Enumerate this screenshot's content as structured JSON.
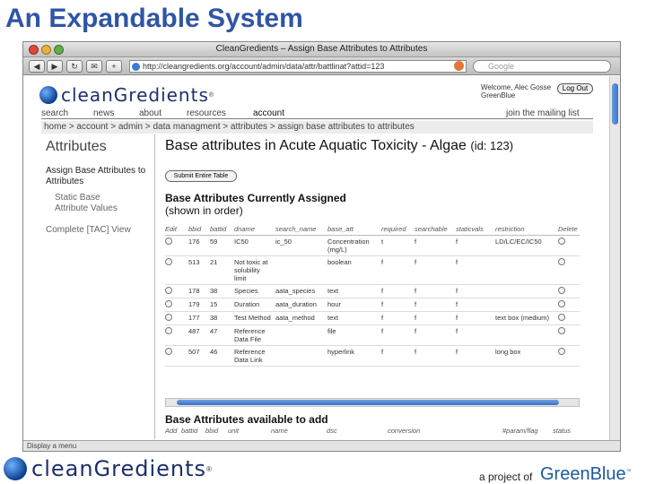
{
  "slide": {
    "title": "An Expandable System"
  },
  "window": {
    "title": "CleanGredients – Assign Base Attributes to Attributes",
    "url": "http://cleangredients.org/account/admin/data/attr/battlinat?attid=123",
    "search_placeholder": "Google",
    "toolbar_buttons": [
      "◀",
      "▶",
      "↻",
      "✉",
      "+"
    ]
  },
  "site": {
    "logo_text": "cleanGredients",
    "logo_mark": "®",
    "user_line1": "Welcome, Alec Gosse",
    "user_line2": "GreenBlue",
    "logout": "Log Out",
    "nav": [
      "search",
      "news",
      "about",
      "resources",
      "account"
    ],
    "join": "join the mailing list",
    "breadcrumb": "home > account > admin > data managment > attributes > assign base attributes to attributes"
  },
  "sidebar": {
    "header": "Attributes",
    "items": [
      "Assign Base Attributes to Attributes",
      "Static Base Attribute Values",
      "Complete [TAC] View"
    ]
  },
  "main": {
    "title": "Base attributes in Acute Aquatic Toxicity - Algae",
    "id_label": "(id: 123)",
    "submit_button": "Submit Entire Table",
    "assigned_title": "Base Attributes Currently Assigned",
    "assigned_sub": "(shown in order)",
    "columns": [
      "Edit",
      "bbid",
      "battid",
      "dname",
      "search_name",
      "base_att",
      "required",
      "searchable",
      "staticvals",
      "restriction",
      "Delete"
    ],
    "rows": [
      [
        "176",
        "59",
        "IC50",
        "ic_50",
        "Concentration (mg/L)",
        "t",
        "f",
        "f",
        "LD/LC/EC/IC50"
      ],
      [
        "513",
        "21",
        "Not toxic at solubility limit",
        "",
        "boolean",
        "f",
        "f",
        "f",
        ""
      ],
      [
        "178",
        "38",
        "Species",
        "aata_species",
        "text",
        "f",
        "f",
        "f",
        ""
      ],
      [
        "179",
        "15",
        "Duration",
        "aata_duration",
        "hour",
        "f",
        "f",
        "f",
        ""
      ],
      [
        "177",
        "38",
        "Test Method",
        "aata_method",
        "text",
        "f",
        "f",
        "f",
        "text box (medium)"
      ],
      [
        "487",
        "47",
        "Reference Data File",
        "",
        "file",
        "f",
        "f",
        "f",
        ""
      ],
      [
        "507",
        "46",
        "Reference Data Link",
        "",
        "hyperlink",
        "f",
        "f",
        "f",
        "long box"
      ]
    ],
    "available_title": "Base Attributes available to add",
    "available_columns": [
      "Add",
      "battid",
      "bbid",
      "unit",
      "name",
      "dsc",
      "conversion",
      "#param/flag",
      "status"
    ]
  },
  "status_bar": "Display a menu",
  "footer": {
    "logo_text": "cleanGredients",
    "logo_mark": "®",
    "project_prefix": "a project of",
    "brand": "GreenBlue",
    "brand_mark": "™"
  },
  "colors": {
    "slide_title": "#2f55a4",
    "logo_blue": "#1c2f6b",
    "brand_green": "#1c5a9c"
  }
}
